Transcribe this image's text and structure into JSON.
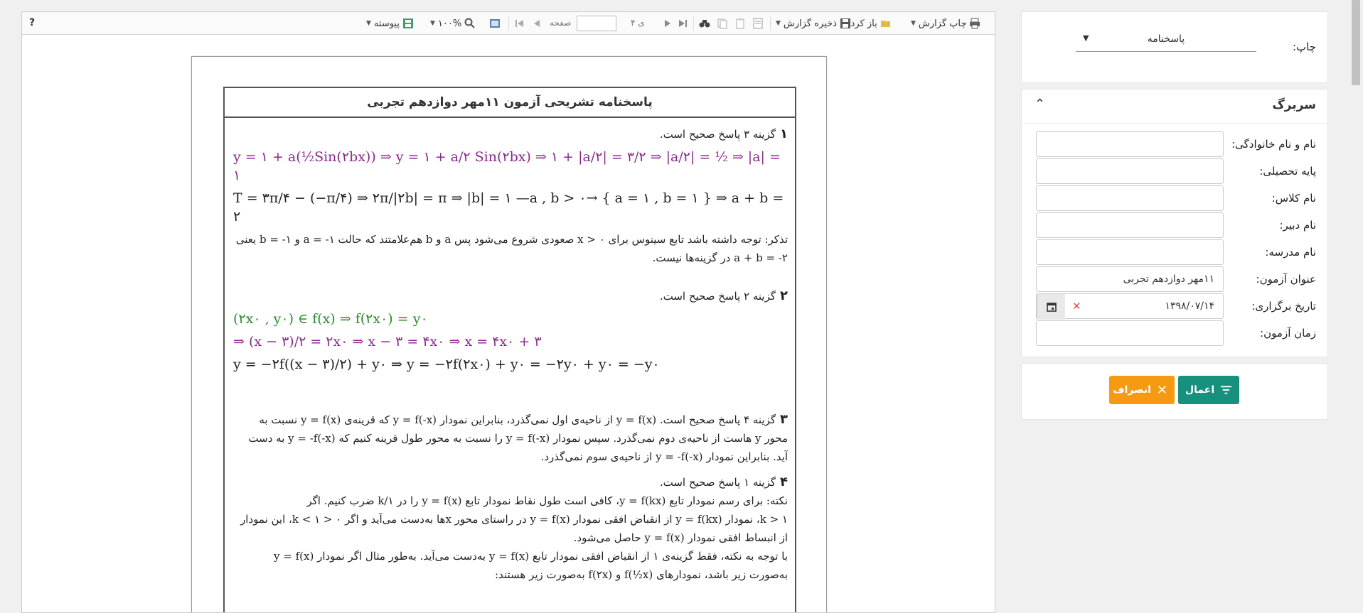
{
  "toolbar": {
    "print_report": "چاپ گزارش",
    "open": "باز کردن",
    "save_report": "ذخیره گزارش",
    "page_label": "صفحه",
    "of_label": "۴ ی",
    "zoom": "۱۰۰%",
    "continuous": "پیوسته",
    "help": "?"
  },
  "document": {
    "title": "پاسخنامه تشریحی آزمون ۱۱مهر دوازدهم تجربی",
    "questions": [
      {
        "num": "۱",
        "head": "گزینه ۳ پاسخ صحیح است.",
        "f1": "y = ۱ + a(½Sin(۲bx)) ⇒ y = ۱ + a/۲ Sin(۲bx) ⇒ ۱ + |a/۲| = ۳/۲ ⇒ |a/۲| = ½ ⇒ |a| = ۱",
        "f2": "T = ۳π/۴ − (−π/۴) ⇒ ۲π/|۲b| = π ⇒ |b| = ۱  —a , b > ۰→  { a = ۱ , b = ۱ } ⇒ a + b = ۲",
        "note": "تذکر: توجه داشته باشد تابع سینوس برای x > ۰ صعودی شروع می‌شود پس a و b هم‌علامتند که حالت a = -۱ و b = -۱ یعنی a + b = -۲ در گزینه‌ها نیست."
      },
      {
        "num": "۲",
        "head": "گزینه ۲ پاسخ صحیح است.",
        "f1": "(۲x۰ , y۰) ∈ f(x) ⇒ f(۲x۰) = y۰",
        "f2": "⇒ (x − ۳)/۲ = ۲x۰ ⇒ x − ۳ = ۴x۰ ⇒ x = ۴x۰ + ۳",
        "f3": "y = −۲f((x − ۳)/۲) + y۰ ⇒ y = −۲f(۲x۰) + y۰ = −۲y۰ + y۰ = −y۰"
      },
      {
        "num": "۳",
        "head": "گزینه ۴ پاسخ صحیح است. y = f(x) از ناحیه‌ی اول نمی‌گذرد، بنابراین نمودار y = f(-x) که قرینه‌ی y = f(x) نسبت به محور y هاست از ناحیه‌ی دوم نمی‌گذرد. سپس نمودار y = f(-x) را نسبت به محور طول قرینه کنیم که y = -f(-x) به دست آید. بنابراین نمودار y = -f(-x) از ناحیه‌ی سوم نمی‌گذرد."
      },
      {
        "num": "۴",
        "head": "گزینه ۱ پاسخ صحیح است.",
        "p1": "نکته: برای رسم نمودار تابع y = f(kx)، کافی است طول نقاط نمودار تابع y = f(x) را در ۱/k ضرب کنیم. اگر",
        "p2": "k > ۱، نمودار y = f(kx) از انقباض افقی نمودار y = f(x) در راستای محور xها به‌دست می‌آید و اگر ۰ < k < ۱، این نمودار از انبساط افقی نمودار y = f(x) حاصل می‌شود.",
        "p3": "با توجه به نکته، فقط گزینه‌ی ۱ از انقباض افقی نمودار تابع y = f(x) به‌دست می‌آید. به‌طور مثال اگر نمودار y = f(x) به‌صورت زیر باشد، نمودارهای f(½x) و f(۲x) به‌صورت زیر هستند:"
      }
    ]
  },
  "print_panel": {
    "label": "چاپ:",
    "selected": "پاسخنامه"
  },
  "header_panel": {
    "title": "سربرگ",
    "fields": [
      {
        "label": "نام و نام خانوادگی:",
        "value": ""
      },
      {
        "label": "پایه تحصیلی:",
        "value": ""
      },
      {
        "label": "نام کلاس:",
        "value": ""
      },
      {
        "label": "نام دبیر:",
        "value": ""
      },
      {
        "label": "نام مدرسه:",
        "value": ""
      },
      {
        "label": "عنوان آزمون:",
        "value": "۱۱مهر دوازدهم تجربی"
      },
      {
        "label": "تاریخ برگزاری:",
        "value": "۱۳۹۸/۰۷/۱۴"
      },
      {
        "label": "زمان آزمون:",
        "value": ""
      }
    ]
  },
  "actions": {
    "apply": "اعمال",
    "cancel": "انصراف"
  },
  "colors": {
    "apply": "#17917d",
    "cancel": "#f59a12",
    "formula_magenta": "#8a2a8a",
    "formula_blue": "#2a2ab0",
    "formula_green": "#2a8a2a"
  }
}
